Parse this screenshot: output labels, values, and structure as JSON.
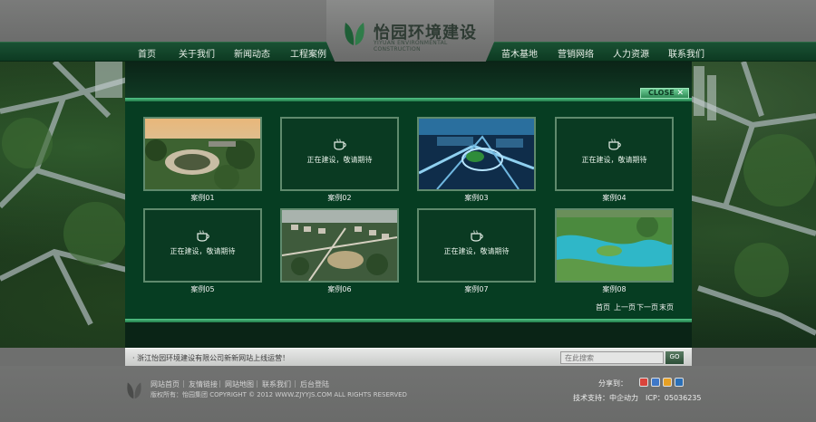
{
  "brand": {
    "name": "怡园环境建设",
    "subtitle": "YIYUAN ENVIRONMENTAL CONSTRUCTION"
  },
  "nav": {
    "left": [
      "首页",
      "关于我们",
      "新闻动态",
      "工程案例"
    ],
    "right": [
      "苗木基地",
      "营销网络",
      "人力资源",
      "联系我们"
    ]
  },
  "popup": {
    "close_label": "CLOSE",
    "close_icon": "✕",
    "placeholder_text": "正在建设，敬请期待",
    "cases": [
      {
        "caption": "案例01",
        "kind": "photo",
        "scene": "garden"
      },
      {
        "caption": "案例02",
        "kind": "placeholder"
      },
      {
        "caption": "案例03",
        "kind": "photo",
        "scene": "city-blue"
      },
      {
        "caption": "案例04",
        "kind": "placeholder"
      },
      {
        "caption": "案例05",
        "kind": "placeholder"
      },
      {
        "caption": "案例06",
        "kind": "photo",
        "scene": "masterplan"
      },
      {
        "caption": "案例07",
        "kind": "placeholder"
      },
      {
        "caption": "案例08",
        "kind": "photo",
        "scene": "lake"
      }
    ],
    "pager": {
      "first": "首页",
      "prev": "上一页",
      "next": "下一页",
      "last": "末页"
    }
  },
  "news": {
    "text": "· 浙江怡园环境建设有限公司新新网站上线运营！",
    "search_placeholder": "在此搜索",
    "go_label": "GO"
  },
  "footer": {
    "links": [
      "网站首页",
      "友情链接",
      "网站地图",
      "联系我们",
      "后台登陆"
    ],
    "separator": "|",
    "copyright": "版权所有：怡园集团 COPYRIGHT © 2012 WWW.ZJYYJS.COM ALL RIGHTS RESERVED",
    "share_label": "分享到：",
    "share_icons": [
      {
        "name": "weibo-icon",
        "color": "#d9443b"
      },
      {
        "name": "qzone-icon",
        "color": "#3f78c8"
      },
      {
        "name": "tencent-weibo-icon",
        "color": "#e8a124"
      },
      {
        "name": "renren-icon",
        "color": "#2a6fb6"
      }
    ],
    "tech_support": "技术支持：中企动力　ICP：05036235"
  },
  "colors": {
    "nav_green": "#0d3a22",
    "popup_green": "#063d22",
    "accent_green": "#56c68a"
  }
}
